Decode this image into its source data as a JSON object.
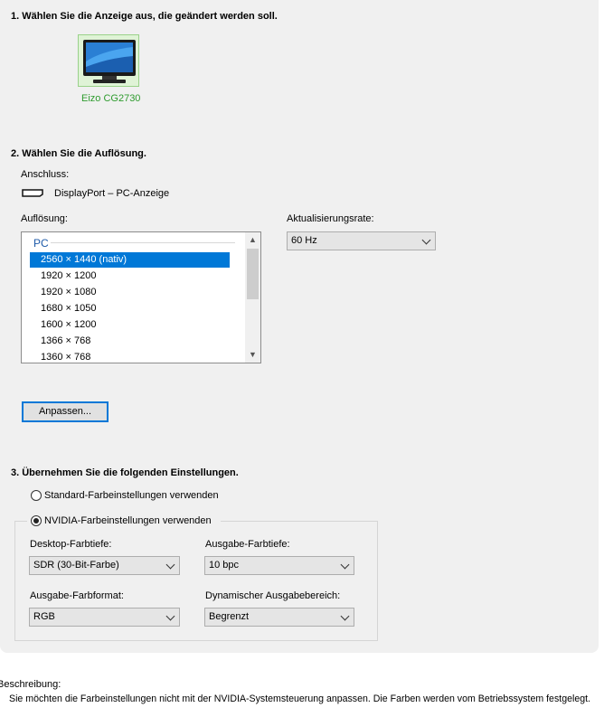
{
  "section1": {
    "heading": "1. Wählen Sie die Anzeige aus, die geändert werden soll.",
    "display": {
      "name": "Eizo CG2730",
      "icon": "monitor-icon"
    }
  },
  "section2": {
    "heading": "2. Wählen Sie die Auflösung.",
    "connection_label": "Anschluss:",
    "connection_value": "DisplayPort – PC-Anzeige",
    "connection_icon": "displayport-icon",
    "resolution_label": "Auflösung:",
    "resolution_group": "PC",
    "resolutions": [
      "2560 × 1440 (nativ)",
      "1920 × 1200",
      "1920 × 1080",
      "1680 × 1050",
      "1600 × 1200",
      "1366 × 768",
      "1360 × 768"
    ],
    "selected_resolution": "2560 × 1440 (nativ)",
    "refresh_label": "Aktualisierungsrate:",
    "refresh_value": "60 Hz",
    "customize_button": "Anpassen..."
  },
  "section3": {
    "heading": "3. Übernehmen Sie die folgenden Einstellungen.",
    "radio_default": {
      "label": "Standard-Farbeinstellungen verwenden",
      "checked": false
    },
    "radio_nvidia": {
      "label": "NVIDIA-Farbeinstellungen verwenden",
      "checked": true
    },
    "desktop_depth_label": "Desktop-Farbtiefe:",
    "desktop_depth_value": "SDR (30-Bit-Farbe)",
    "output_depth_label": "Ausgabe-Farbtiefe:",
    "output_depth_value": "10 bpc",
    "output_format_label": "Ausgabe-Farbformat:",
    "output_format_value": "RGB",
    "dynamic_range_label": "Dynamischer Ausgabebereich:",
    "dynamic_range_value": "Begrenzt"
  },
  "description": {
    "label": "Beschreibung:",
    "text": "Sie möchten die Farbeinstellungen nicht mit der NVIDIA-Systemsteuerung anpassen. Die Farben werden vom Betriebssystem festgelegt."
  },
  "colors": {
    "accent": "#0078d7",
    "selection_green": "#2e9b2e",
    "group_blue": "#1e5aa8"
  }
}
